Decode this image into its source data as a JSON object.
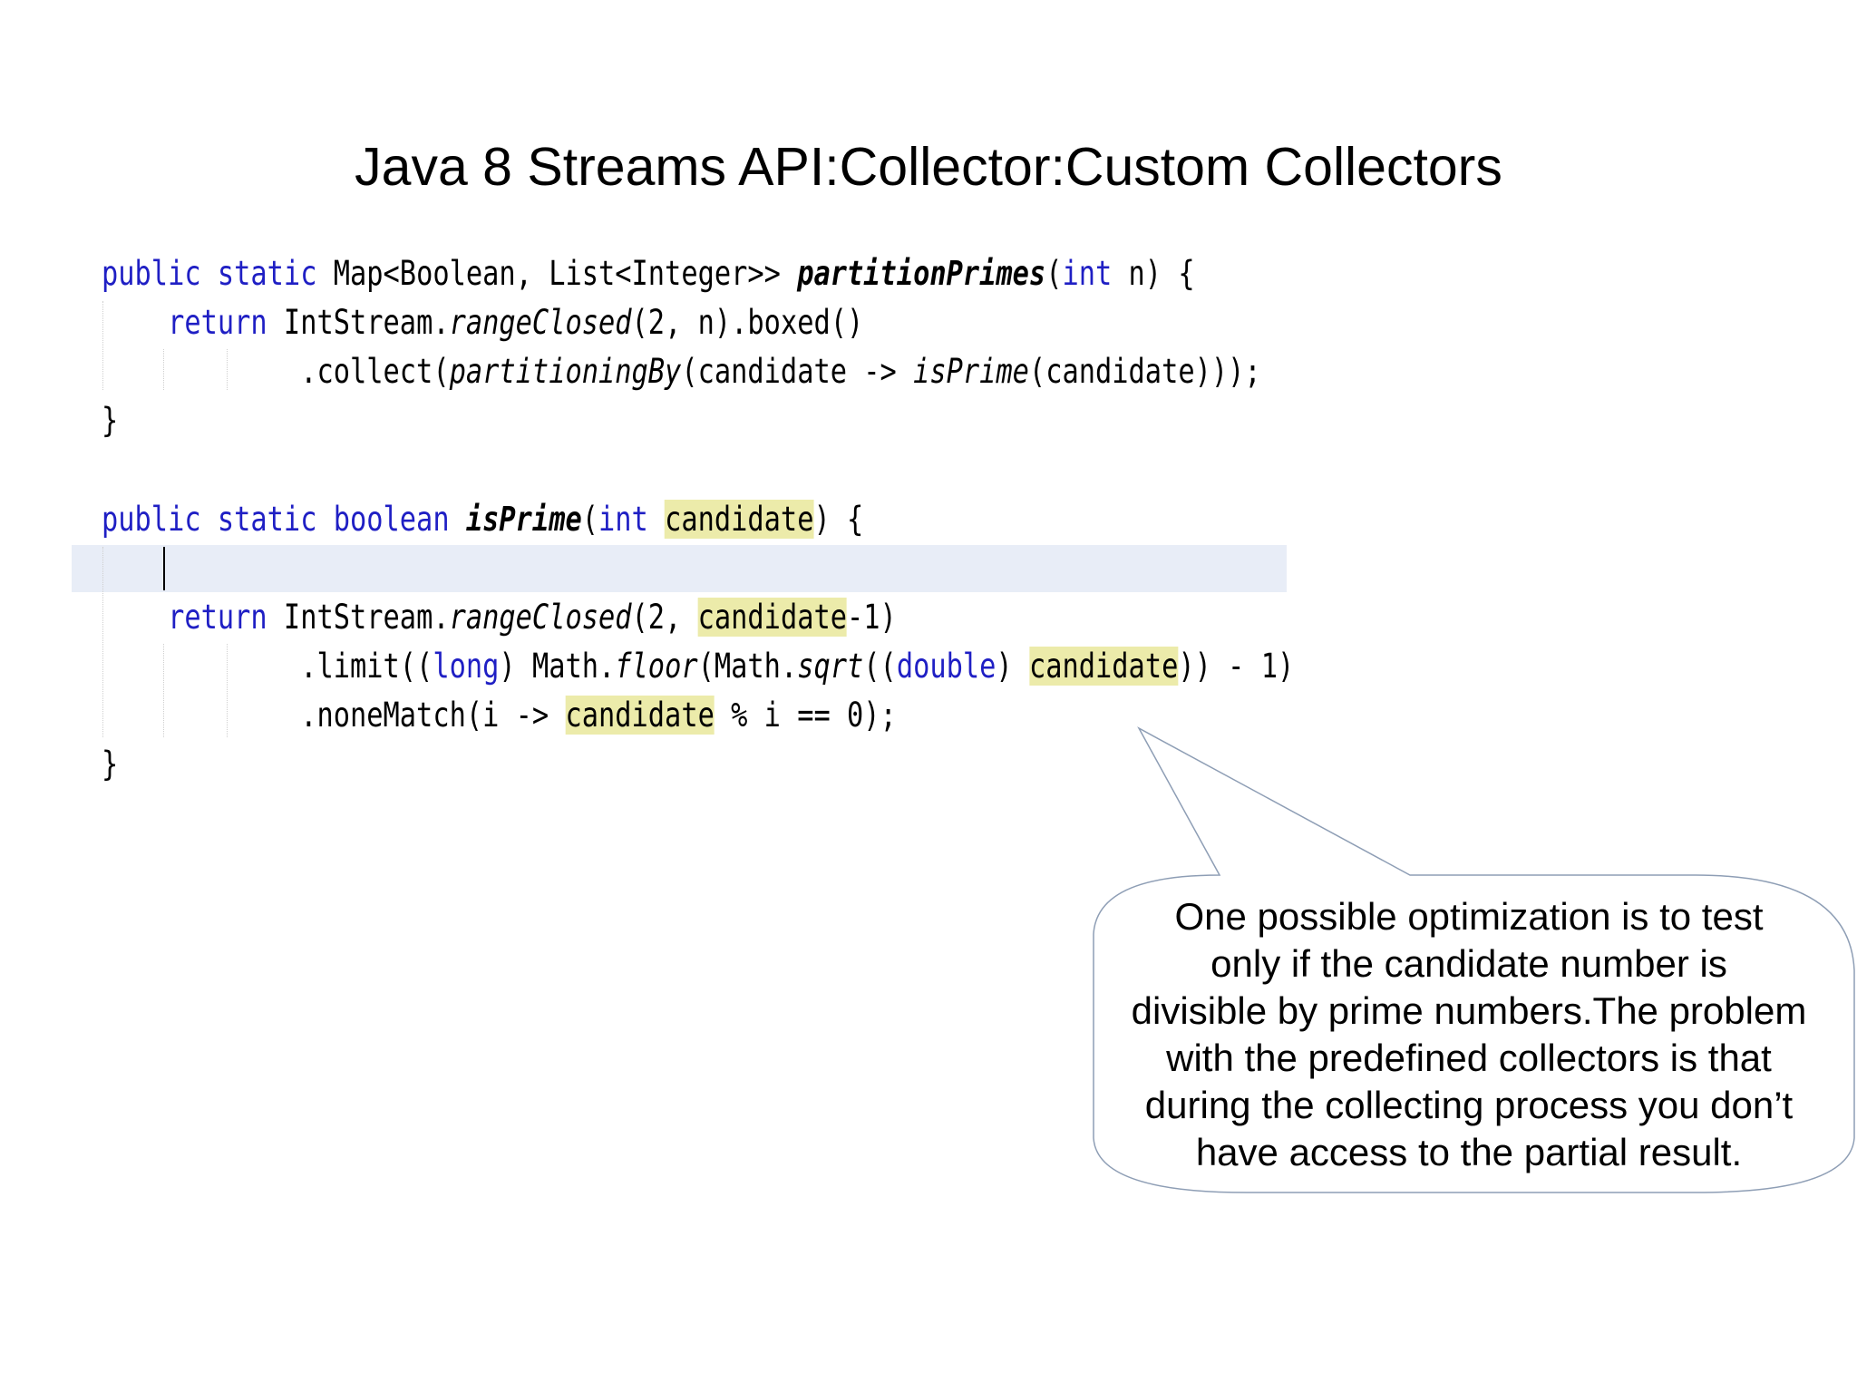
{
  "slide": {
    "title": "Java 8 Streams API:Collector:Custom Collectors"
  },
  "code": {
    "l1": {
      "t1": "public static",
      "t2": " Map<Boolean, List<Integer>> ",
      "t3": "partitionPrimes",
      "t4": "(",
      "t5": "int",
      "t6": " n) {"
    },
    "l2": {
      "t1": "    ",
      "t2": "return",
      "t3": " IntStream.",
      "t4": "rangeClosed",
      "t5": "(2, n).boxed()"
    },
    "l3": {
      "t1": "            .collect(",
      "t2": "partitioningBy",
      "t3": "(candidate -> ",
      "t4": "isPrime",
      "t5": "(candidate)));"
    },
    "l4": {
      "t1": "}"
    },
    "l5": {
      "t1": "public static boolean",
      "t2": " ",
      "t3": "isPrime",
      "t4": "(",
      "t5": "int",
      "t6": " ",
      "t7": "candidate",
      "t8": ") {"
    },
    "l6": {
      "t1": "    ",
      "t2": "return",
      "t3": " IntStream.",
      "t4": "rangeClosed",
      "t5": "(2, ",
      "t6": "candidate",
      "t7": "-1)"
    },
    "l7": {
      "t1": "            .limit((",
      "t2": "long",
      "t3": ") Math.",
      "t4": "floor",
      "t5": "(Math.",
      "t6": "sqrt",
      "t7": "((",
      "t8": "double",
      "t9": ") ",
      "t10": "candidate",
      "t11": ")) - 1)"
    },
    "l8": {
      "t1": "            .noneMatch(i -> ",
      "t2": "candidate",
      "t3": " % i == 0);"
    },
    "l9": {
      "t1": "}"
    }
  },
  "callout": {
    "lines": [
      "One possible optimization is to test",
      "only if the candidate number is",
      "divisible by prime numbers.The problem",
      "with the predefined collectors is that",
      "during the collecting process you don’t",
      "have access to the partial result."
    ]
  },
  "colors": {
    "keyword": "#1f1fc4",
    "highlight": "#ecebaa",
    "current_line": "#e8edf7",
    "callout_border": "#8e9eb5"
  }
}
